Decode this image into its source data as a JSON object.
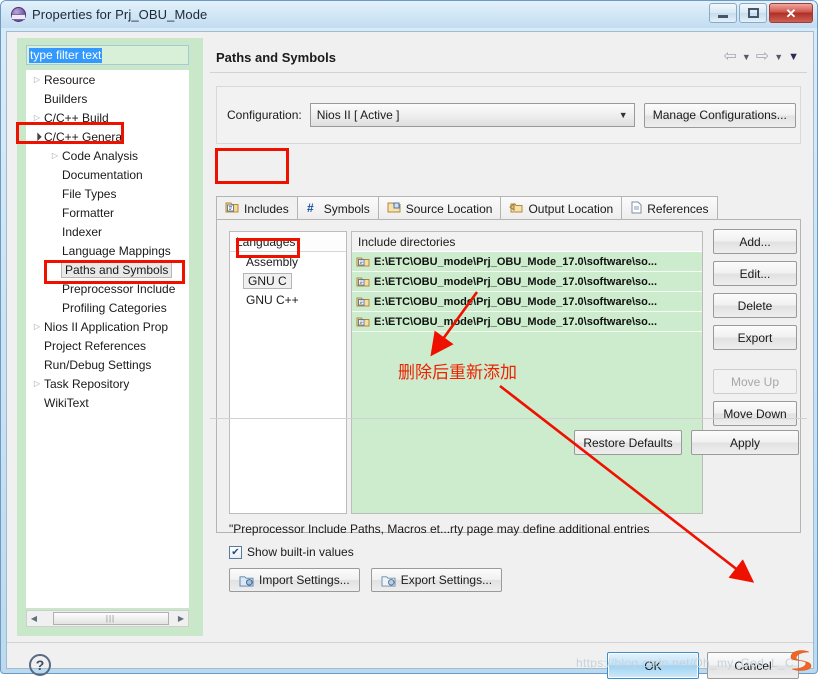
{
  "window": {
    "title": "Properties for Prj_OBU_Mode",
    "icon": "properties-app-icon",
    "buttons": {
      "minimize": "minimize-button",
      "maximize": "maximize-button",
      "close": "✕"
    }
  },
  "sidebar": {
    "filter_value": "type filter text",
    "filter_placeholder": "type filter text",
    "items": [
      {
        "label": "Resource",
        "indent": 1,
        "arrow": "collapsed",
        "selected": false
      },
      {
        "label": "Builders",
        "indent": 1,
        "arrow": "none",
        "selected": false
      },
      {
        "label": "C/C++ Build",
        "indent": 1,
        "arrow": "collapsed",
        "selected": false
      },
      {
        "label": "C/C++ General",
        "indent": 1,
        "arrow": "expanded",
        "selected": false
      },
      {
        "label": "Code Analysis",
        "indent": 2,
        "arrow": "collapsed",
        "selected": false
      },
      {
        "label": "Documentation",
        "indent": 2,
        "arrow": "none",
        "selected": false
      },
      {
        "label": "File Types",
        "indent": 2,
        "arrow": "none",
        "selected": false
      },
      {
        "label": "Formatter",
        "indent": 2,
        "arrow": "none",
        "selected": false
      },
      {
        "label": "Indexer",
        "indent": 2,
        "arrow": "none",
        "selected": false
      },
      {
        "label": "Language Mappings",
        "indent": 2,
        "arrow": "none",
        "selected": false
      },
      {
        "label": "Paths and Symbols",
        "indent": 2,
        "arrow": "none",
        "selected": true
      },
      {
        "label": "Preprocessor Include",
        "indent": 2,
        "arrow": "none",
        "selected": false
      },
      {
        "label": "Profiling Categories",
        "indent": 2,
        "arrow": "none",
        "selected": false
      },
      {
        "label": "Nios II Application Prop",
        "indent": 1,
        "arrow": "collapsed",
        "selected": false
      },
      {
        "label": "Project References",
        "indent": 1,
        "arrow": "none",
        "selected": false
      },
      {
        "label": "Run/Debug Settings",
        "indent": 1,
        "arrow": "none",
        "selected": false
      },
      {
        "label": "Task Repository",
        "indent": 1,
        "arrow": "collapsed",
        "selected": false
      },
      {
        "label": "WikiText",
        "indent": 1,
        "arrow": "none",
        "selected": false
      }
    ]
  },
  "page": {
    "title": "Paths and Symbols",
    "config_label": "Configuration:",
    "config_value": "Nios II  [ Active ]",
    "manage_configurations": "Manage Configurations...",
    "tabs": [
      {
        "label": "Includes",
        "icon": "includes-icon",
        "active": true
      },
      {
        "label": "Symbols",
        "icon": "hash-icon",
        "active": false
      },
      {
        "label": "Source Location",
        "icon": "source-folder-icon",
        "active": false
      },
      {
        "label": "Output Location",
        "icon": "output-folder-icon",
        "active": false
      },
      {
        "label": "References",
        "icon": "references-page-icon",
        "active": false
      }
    ],
    "languages_header": "Languages",
    "languages": [
      {
        "label": "Assembly",
        "selected": false
      },
      {
        "label": "GNU C",
        "selected": true
      },
      {
        "label": "GNU C++",
        "selected": false
      }
    ],
    "includes_header": "Include directories",
    "include_entries": [
      "E:\\ETC\\OBU_mode\\Prj_OBU_Mode_17.0\\software\\so...",
      "E:\\ETC\\OBU_mode\\Prj_OBU_Mode_17.0\\software\\so...",
      "E:\\ETC\\OBU_mode\\Prj_OBU_Mode_17.0\\software\\so...",
      "E:\\ETC\\OBU_mode\\Prj_OBU_Mode_17.0\\software\\so..."
    ],
    "side_buttons": [
      {
        "label": "Add...",
        "disabled": false
      },
      {
        "label": "Edit...",
        "disabled": false
      },
      {
        "label": "Delete",
        "disabled": false
      },
      {
        "label": "Export",
        "disabled": false
      }
    ],
    "move_buttons": [
      {
        "label": "Move Up",
        "disabled": true
      },
      {
        "label": "Move Down",
        "disabled": false
      }
    ],
    "footnote": "\"Preprocessor Include Paths, Macros et...rty page may define additional entries",
    "show_builtin_label": "Show built-in values",
    "show_builtin_checked": true,
    "import_settings": "Import Settings...",
    "export_settings": "Export Settings...",
    "restore_defaults": "Restore Defaults",
    "apply": "Apply"
  },
  "footer": {
    "help": "?",
    "ok": "OK",
    "cancel": "Cancel"
  },
  "annotations": {
    "chinese_note": "删除后重新添加",
    "color": "#ee1100",
    "boxes": [
      "C/C++ General",
      "Paths and Symbols",
      "Includes tab",
      "GNU C"
    ]
  },
  "watermark": "https://blog.csdn.net/Oh_my_God_L_C"
}
